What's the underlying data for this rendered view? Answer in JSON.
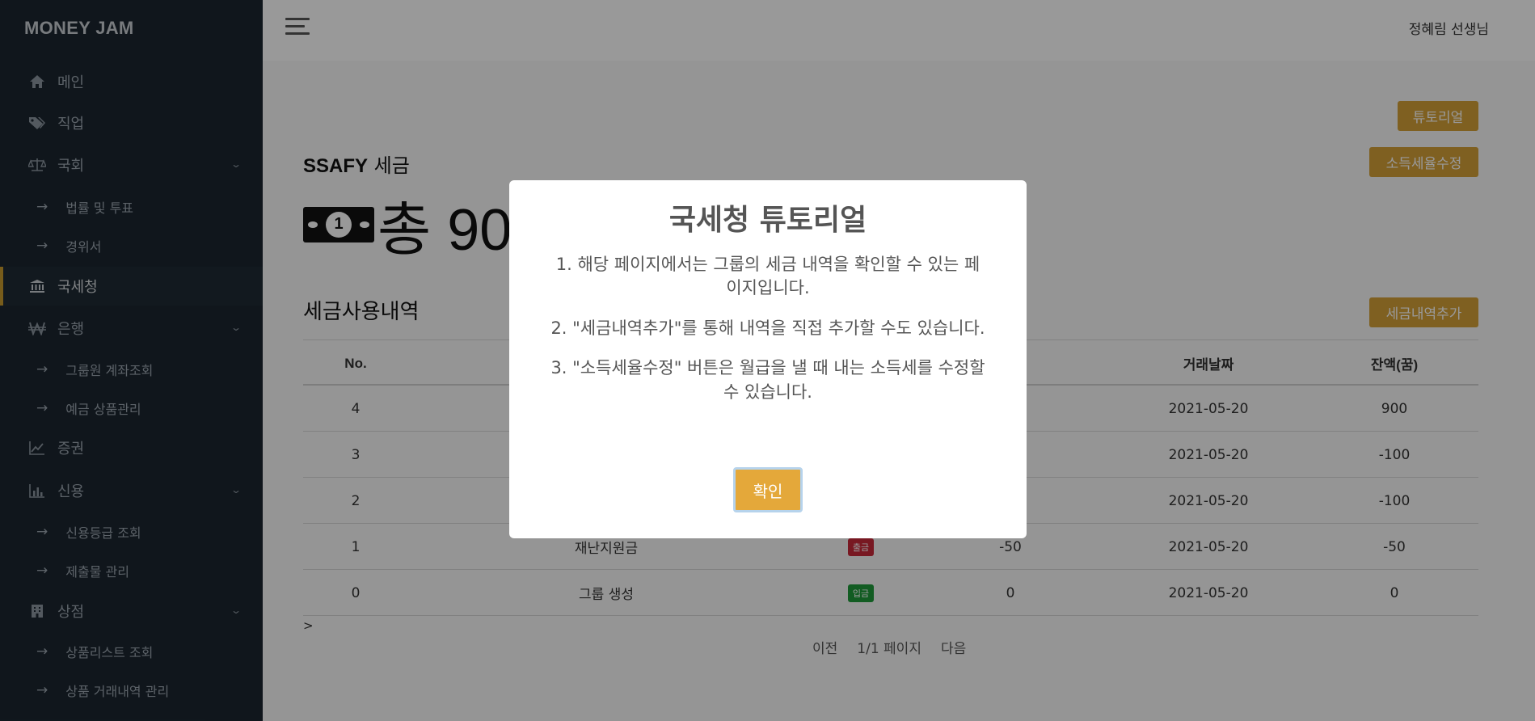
{
  "app": {
    "brand": "MONEY JAM"
  },
  "sidebar": {
    "items": [
      {
        "label": "메인",
        "icon": "home-icon"
      },
      {
        "label": "직업",
        "icon": "tags-icon"
      },
      {
        "label": "국회",
        "icon": "scale-icon"
      },
      {
        "label": "법률 및 투표"
      },
      {
        "label": "경위서"
      },
      {
        "label": "국세청",
        "icon": "bank-icon"
      },
      {
        "label": "은행",
        "icon": "won-icon"
      },
      {
        "label": "그룹원 계좌조회"
      },
      {
        "label": "예금 상품관리"
      },
      {
        "label": "증권",
        "icon": "chart-line-icon"
      },
      {
        "label": "신용",
        "icon": "chart-bar-icon"
      },
      {
        "label": "신용등급 조회"
      },
      {
        "label": "제출물 관리"
      },
      {
        "label": "상점",
        "icon": "building-icon"
      },
      {
        "label": "상품리스트 조회"
      },
      {
        "label": "상품 거래내역 관리"
      }
    ],
    "arrow": "→"
  },
  "header": {
    "user": "정혜림 선생님"
  },
  "main": {
    "tutorial_button": "튜토리얼",
    "tax_rate_button": "소득세율수정",
    "title_bold": "SSAFY",
    "title_rest": "세금",
    "total": "총 90",
    "section_title": "세금사용내역",
    "add_button": "세금내역추가",
    "table": {
      "headers": [
        "No.",
        "",
        "",
        "",
        "거래날짜",
        "잔액(꿈)"
      ],
      "rows": [
        {
          "no": "4",
          "name": "",
          "badge": "",
          "amount": "",
          "date": "2021-05-20",
          "balance": "900"
        },
        {
          "no": "3",
          "name": "",
          "badge": "",
          "amount": "",
          "date": "2021-05-20",
          "balance": "-100"
        },
        {
          "no": "2",
          "name": "",
          "badge": "",
          "amount": "",
          "date": "2021-05-20",
          "balance": "-100"
        },
        {
          "no": "1",
          "name": "재난지원금",
          "badge": "출금",
          "amount": "-50",
          "date": "2021-05-20",
          "balance": "-50"
        },
        {
          "no": "0",
          "name": "그룹 생성",
          "badge": "입금",
          "amount": "0",
          "date": "2021-05-20",
          "balance": "0"
        }
      ]
    },
    "stray": ">",
    "pager": {
      "prev": "이전",
      "info": "1/1 페이지",
      "next": "다음"
    }
  },
  "modal": {
    "title": "국세청 튜토리얼",
    "lines": [
      "1. 해당 페이지에서는 그룹의 세금 내역을 확인할 수 있는 페이지입니다.",
      "2. \"세금내역추가\"를 통해 내역을 직접 추가할 수도 있습니다.",
      "3. \"소득세율수정\" 버튼은 월급을 낼 때 내는 소득세를 수정할 수 있습니다."
    ],
    "confirm": "확인"
  },
  "colors": {
    "sidebar": "#1b2630",
    "gold": "#d4a037",
    "overlay": "rgba(0,0,0,0.4)",
    "confirm": "#e4a83a"
  }
}
